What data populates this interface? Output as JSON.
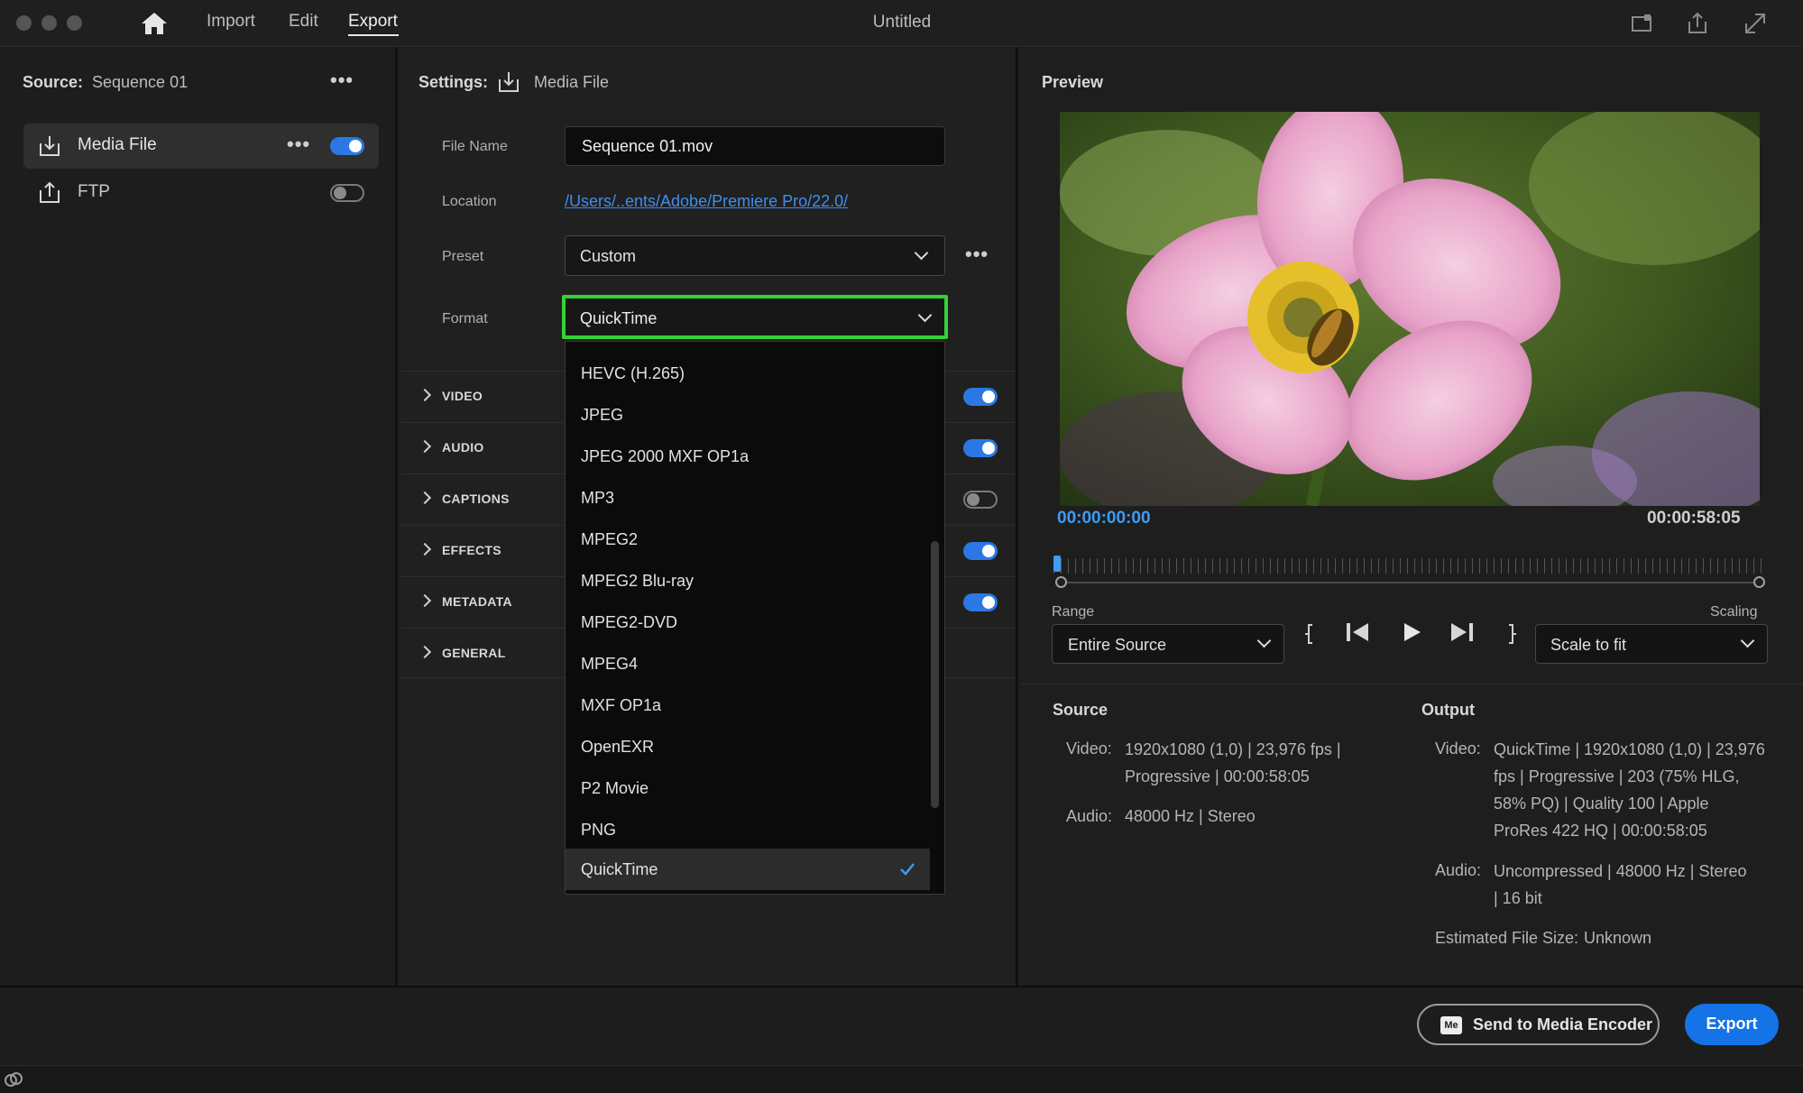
{
  "window": {
    "title": "Untitled"
  },
  "nav": {
    "tabs": [
      "Import",
      "Edit",
      "Export"
    ],
    "active": "Export"
  },
  "source": {
    "label": "Source:",
    "value": "Sequence 01"
  },
  "destinations": [
    {
      "label": "Media File",
      "enabled": true
    },
    {
      "label": "FTP",
      "enabled": false
    }
  ],
  "settings": {
    "label": "Settings:",
    "destination": "Media File",
    "file_name_label": "File Name",
    "file_name": "Sequence 01.mov",
    "location_label": "Location",
    "location": "/Users/..ents/Adobe/Premiere Pro/22.0/",
    "preset_label": "Preset",
    "preset": "Custom",
    "format_label": "Format",
    "format": "QuickTime"
  },
  "sections": [
    {
      "label": "VIDEO",
      "enabled": true
    },
    {
      "label": "AUDIO",
      "enabled": true
    },
    {
      "label": "CAPTIONS",
      "enabled": false
    },
    {
      "label": "EFFECTS",
      "enabled": true
    },
    {
      "label": "METADATA",
      "enabled": true
    },
    {
      "label": "GENERAL"
    }
  ],
  "format_options": [
    "HEVC (H.265)",
    "JPEG",
    "JPEG 2000 MXF OP1a",
    "MP3",
    "MPEG2",
    "MPEG2 Blu-ray",
    "MPEG2-DVD",
    "MPEG4",
    "MXF OP1a",
    "OpenEXR",
    "P2 Movie",
    "PNG",
    "QuickTime"
  ],
  "format_selected": "QuickTime",
  "preview": {
    "title": "Preview",
    "timecode_current": "00:00:00:00",
    "timecode_duration": "00:00:58:05",
    "range_label": "Range",
    "range": "Entire Source",
    "scaling_label": "Scaling",
    "scaling": "Scale to fit"
  },
  "source_info": {
    "heading": "Source",
    "video_label": "Video:",
    "video_lines": [
      "1920x1080 (1,0)  |  23,976 fps  |",
      "Progressive  |  00:00:58:05"
    ],
    "audio_label": "Audio:",
    "audio_lines": [
      "48000 Hz  |  Stereo"
    ]
  },
  "output_info": {
    "heading": "Output",
    "video_label": "Video:",
    "video_lines": [
      "QuickTime  |  1920x1080 (1,0)  |  23,976",
      "fps  |  Progressive  |  203 (75% HLG,",
      "58% PQ)  |  Quality 100  |  Apple",
      "ProRes 422 HQ  |  00:00:58:05"
    ],
    "audio_label": "Audio:",
    "audio_lines": [
      "Uncompressed  |  48000 Hz  |  Stereo",
      "|  16 bit"
    ],
    "file_size_label": "Estimated File Size:",
    "file_size": "Unknown"
  },
  "buttons": {
    "send_to_encoder": "Send to Media Encoder",
    "encoder_badge": "Me",
    "export": "Export"
  },
  "colors": {
    "accent": "#1473e6",
    "timecode": "#3e9cf2",
    "highlight": "#35d235",
    "link": "#3e8ef0"
  }
}
